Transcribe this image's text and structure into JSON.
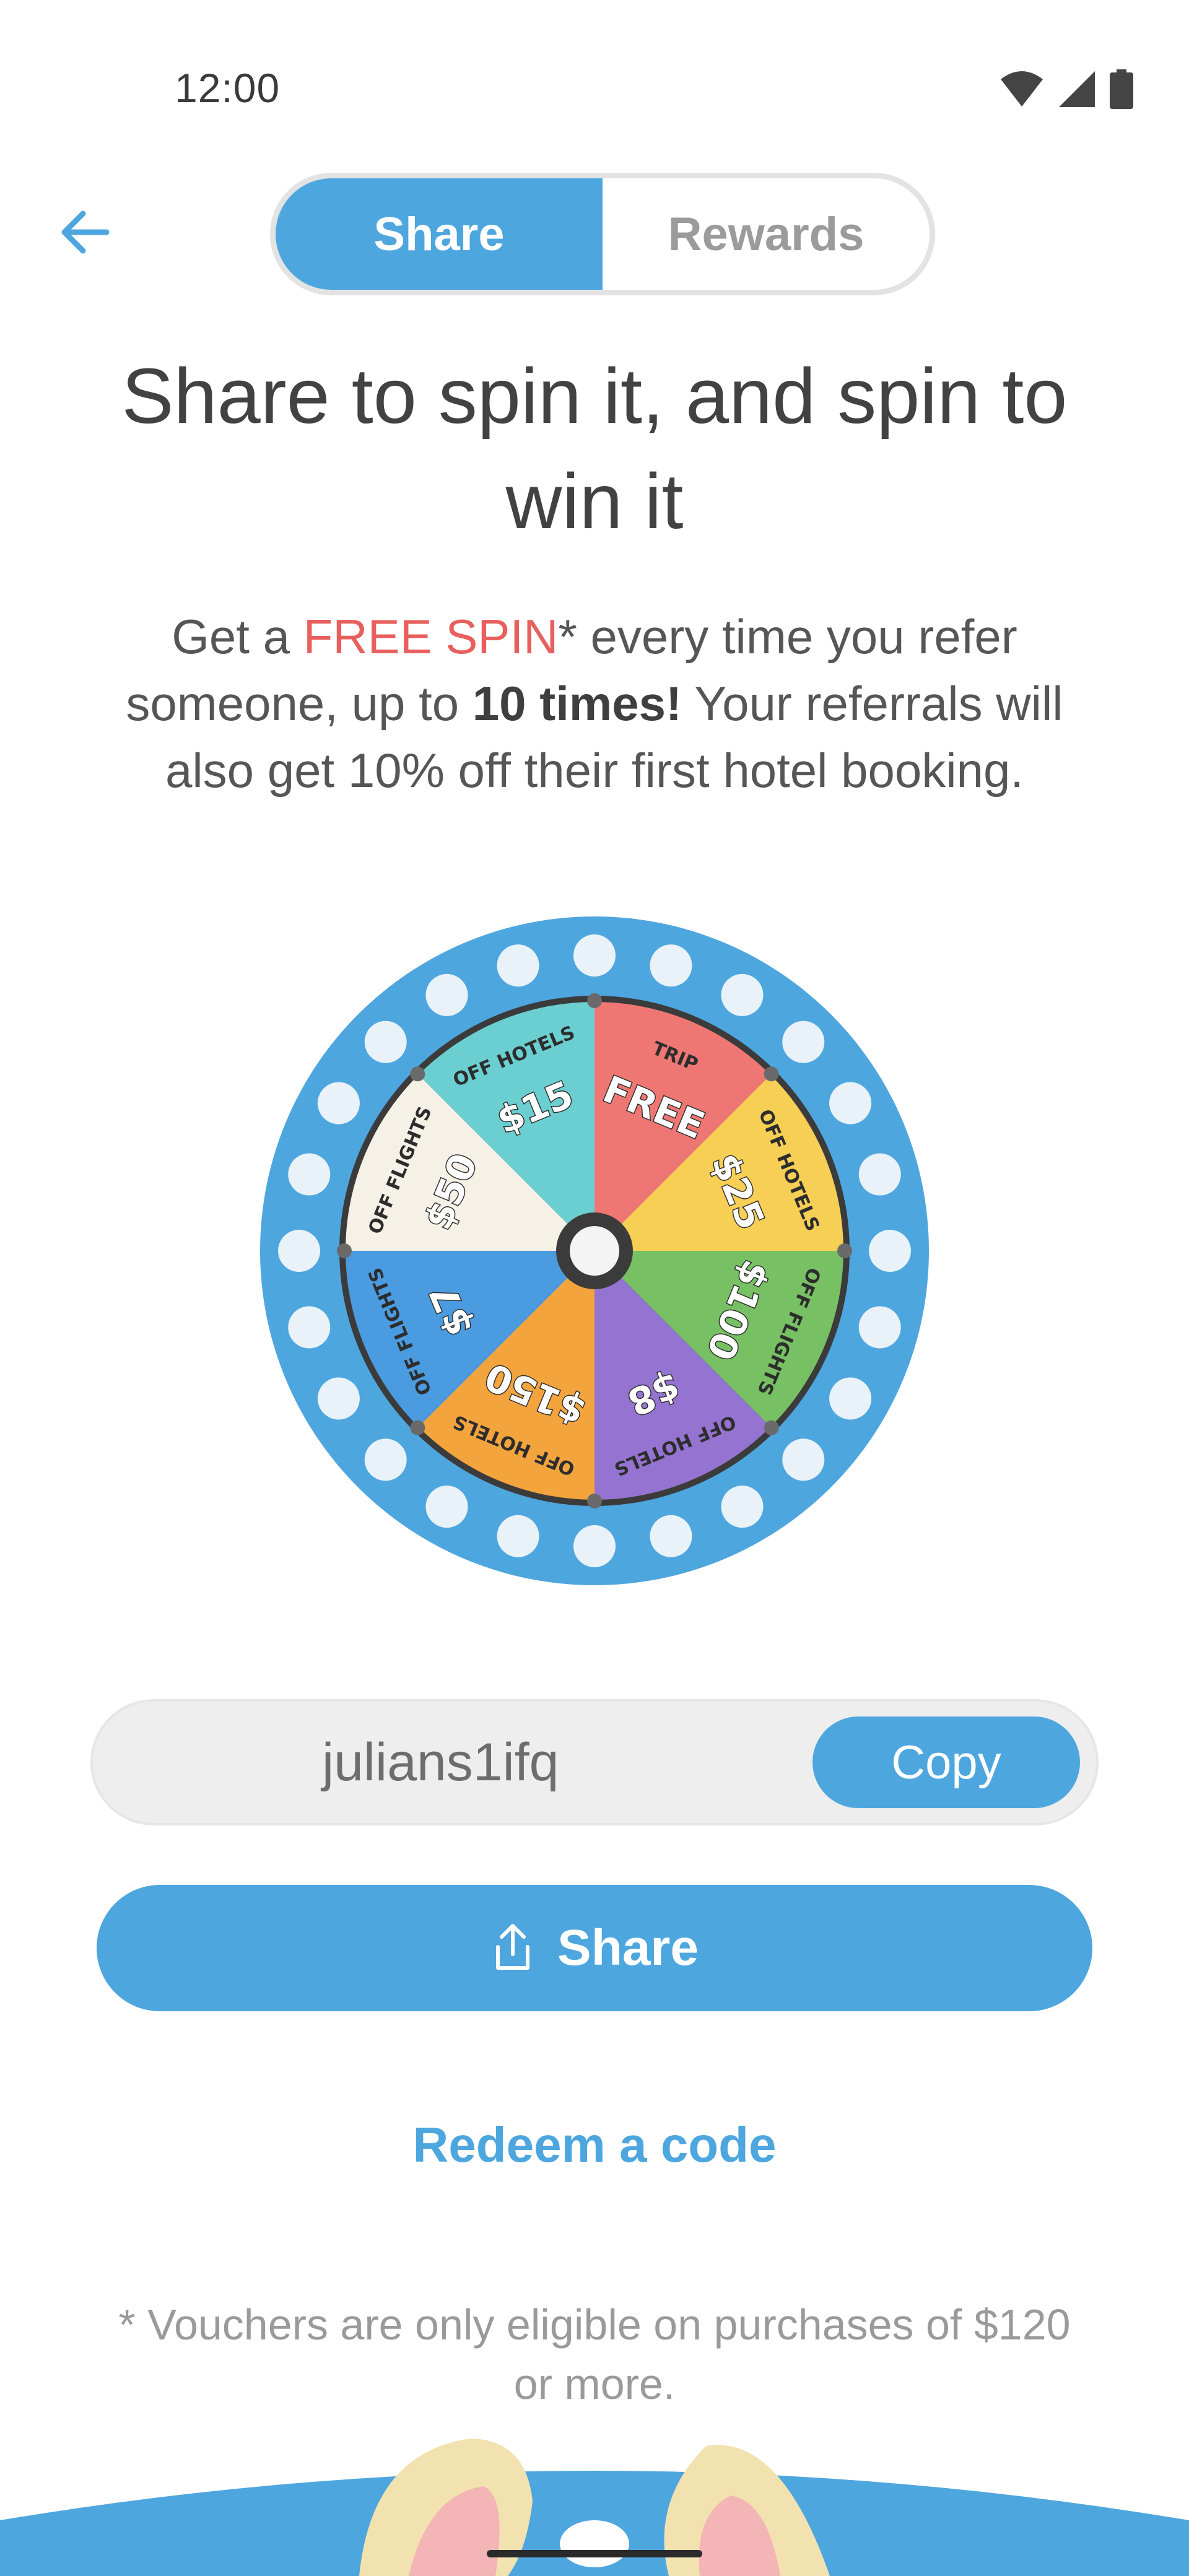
{
  "status_bar": {
    "time": "12:00"
  },
  "tabs": {
    "share": "Share",
    "rewards": "Rewards"
  },
  "headline": "Share to spin it, and spin to win it",
  "description": {
    "p1": "Get a ",
    "free_spin": "FREE SPIN",
    "p2": "* every time you refer someone, up to ",
    "ten_times": "10 times!",
    "p3": " Your referrals will also get 10% off their first hotel booking."
  },
  "wheel": {
    "segments": [
      {
        "big": "FREE",
        "small": "TRIP",
        "color": "#ee7774"
      },
      {
        "big": "$25",
        "small": "OFF HOTELS",
        "color": "#f7cf55"
      },
      {
        "big": "$100",
        "small": "OFF FLIGHTS",
        "color": "#78c064"
      },
      {
        "big": "$8",
        "small": "OFF HOTELS",
        "color": "#9574d1"
      },
      {
        "big": "$150",
        "small": "OFF HOTELS",
        "color": "#f3a43d"
      },
      {
        "big": "$7",
        "small": "OFF FLIGHTS",
        "color": "#4b9be0"
      },
      {
        "big": "$50",
        "small": "OFF FLIGHTS",
        "color": "#f6f1e6"
      },
      {
        "big": "$15",
        "small": "OFF HOTELS",
        "color": "#6bcfd1"
      }
    ],
    "rim_color": "#4ea6df"
  },
  "referral": {
    "code": "julians1ifq",
    "copy_label": "Copy"
  },
  "share_button": {
    "label": "Share"
  },
  "redeem_link": "Redeem a code",
  "footnote": "* Vouchers are only eligible on purchases of $120 or more.",
  "colors": {
    "accent": "#4ea6df",
    "highlight": "#e8605e"
  }
}
